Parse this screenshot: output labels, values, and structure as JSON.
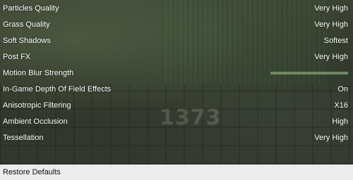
{
  "settings": [
    {
      "label": "Particles Quality",
      "value": "Very High"
    },
    {
      "label": "Grass Quality",
      "value": "Very High"
    },
    {
      "label": "Soft Shadows",
      "value": "Softest"
    },
    {
      "label": "Post FX",
      "value": "Very High"
    },
    {
      "label": "Motion Blur Strength",
      "slider_level": 1.0
    },
    {
      "label": "In-Game Depth Of Field Effects",
      "value": "On"
    },
    {
      "label": "Anisotropic Filtering",
      "value": "X16"
    },
    {
      "label": "Ambient Occlusion",
      "value": "High"
    },
    {
      "label": "Tessellation",
      "value": "Very High"
    }
  ],
  "footer": {
    "restore_label": "Restore Defaults"
  },
  "background": {
    "sign_text": "1373"
  },
  "colors": {
    "text": "#ffffff",
    "slider_fill": "#6c8a60",
    "footer_bg": "#ececec"
  }
}
